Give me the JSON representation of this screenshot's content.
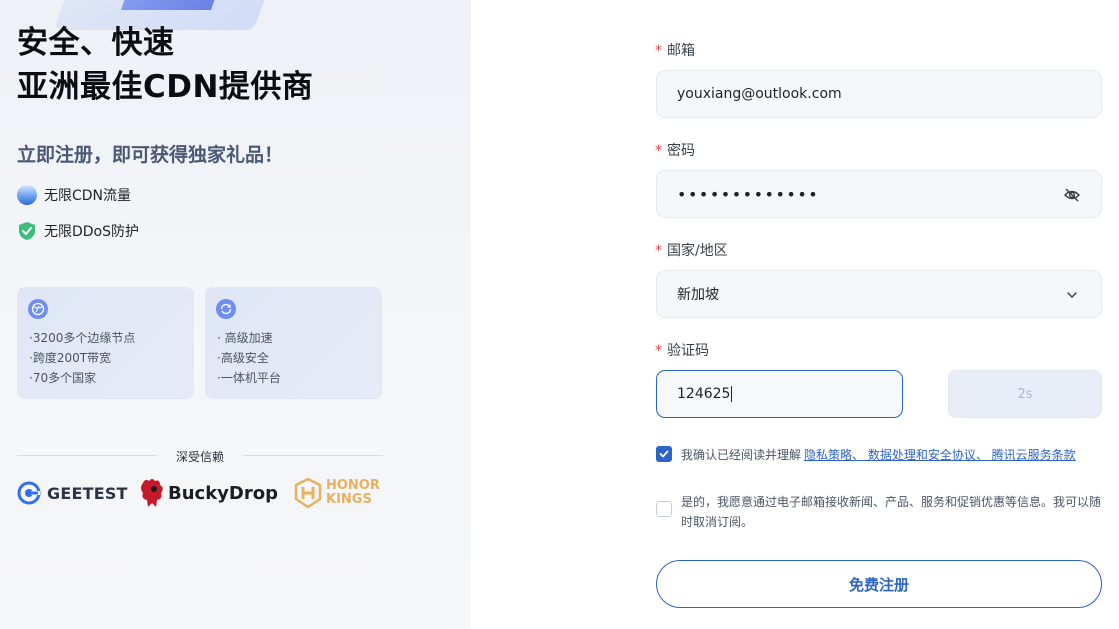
{
  "hero": {
    "title_line1": "安全、快速",
    "title_line2": "亚洲最佳CDN提供商",
    "promo": "立即注册，即可获得独家礼品！"
  },
  "features": [
    {
      "label": "无限CDN流量",
      "icon": "cdn-globe-icon"
    },
    {
      "label": "无限DDoS防护",
      "icon": "shield-check-icon"
    }
  ],
  "cards": [
    {
      "icon": "network-globe-icon",
      "lines": [
        "·3200多个边缘节点",
        "·跨度200T带宽",
        "·70多个国家"
      ]
    },
    {
      "icon": "speed-cycle-icon",
      "lines": [
        "· 高级加速",
        "·高级安全",
        "·一体机平台"
      ]
    }
  ],
  "trust": {
    "label": "深受信赖",
    "logos": [
      {
        "name": "GEETEST",
        "icon": "geetest-logo"
      },
      {
        "name": "BuckyDrop",
        "icon": "buckydrop-logo"
      },
      {
        "name_line1": "HONOR",
        "name_line2": "KINGS",
        "icon": "honor-of-kings-logo"
      }
    ]
  },
  "form": {
    "required_mark": "*",
    "email": {
      "label": "邮箱",
      "value": "youxiang@outlook.com"
    },
    "password": {
      "label": "密码",
      "value": "•••••••••••••"
    },
    "country": {
      "label": "国家/地区",
      "value": "新加坡"
    },
    "code": {
      "label": "验证码",
      "value": "124625",
      "send_label": "2s"
    },
    "consent1": {
      "checked": true,
      "prefix": "我确认已经阅读并理解",
      "link": "隐私策略、 数据处理和安全协议、 腾讯云服务条款"
    },
    "consent2": {
      "checked": false,
      "text": "是的，我愿意通过电子邮箱接收新闻、产品、服务和促销优惠等信息。我可以随时取消订阅。"
    },
    "submit_label": "免费注册"
  },
  "colors": {
    "accent": "#2c64c8",
    "required": "#e54545",
    "shield": "#3dbd7d"
  }
}
